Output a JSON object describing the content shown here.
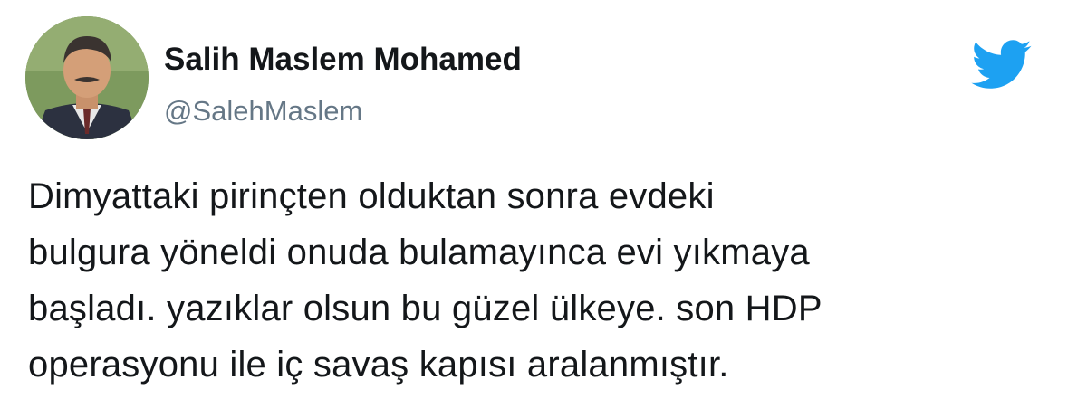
{
  "author": {
    "display_name": "Salih Maslem Mohamed",
    "handle": "@SalehMaslem"
  },
  "icons": {
    "avatar": "profile-photo",
    "logo": "twitter-bird-icon"
  },
  "colors": {
    "twitter_blue": "#1da1f2",
    "text": "#14171a",
    "secondary_text": "#657786"
  },
  "tweet": {
    "lines": [
      "Dimyattaki pirinçten olduktan sonra evdeki",
      "bulgura yöneldi onuda bulamayınca evi yıkmaya",
      "başladı. yazıklar olsun bu güzel ülkeye. son HDP",
      "operasyonu ile iç savaş kapısı aralanmıştır."
    ]
  }
}
